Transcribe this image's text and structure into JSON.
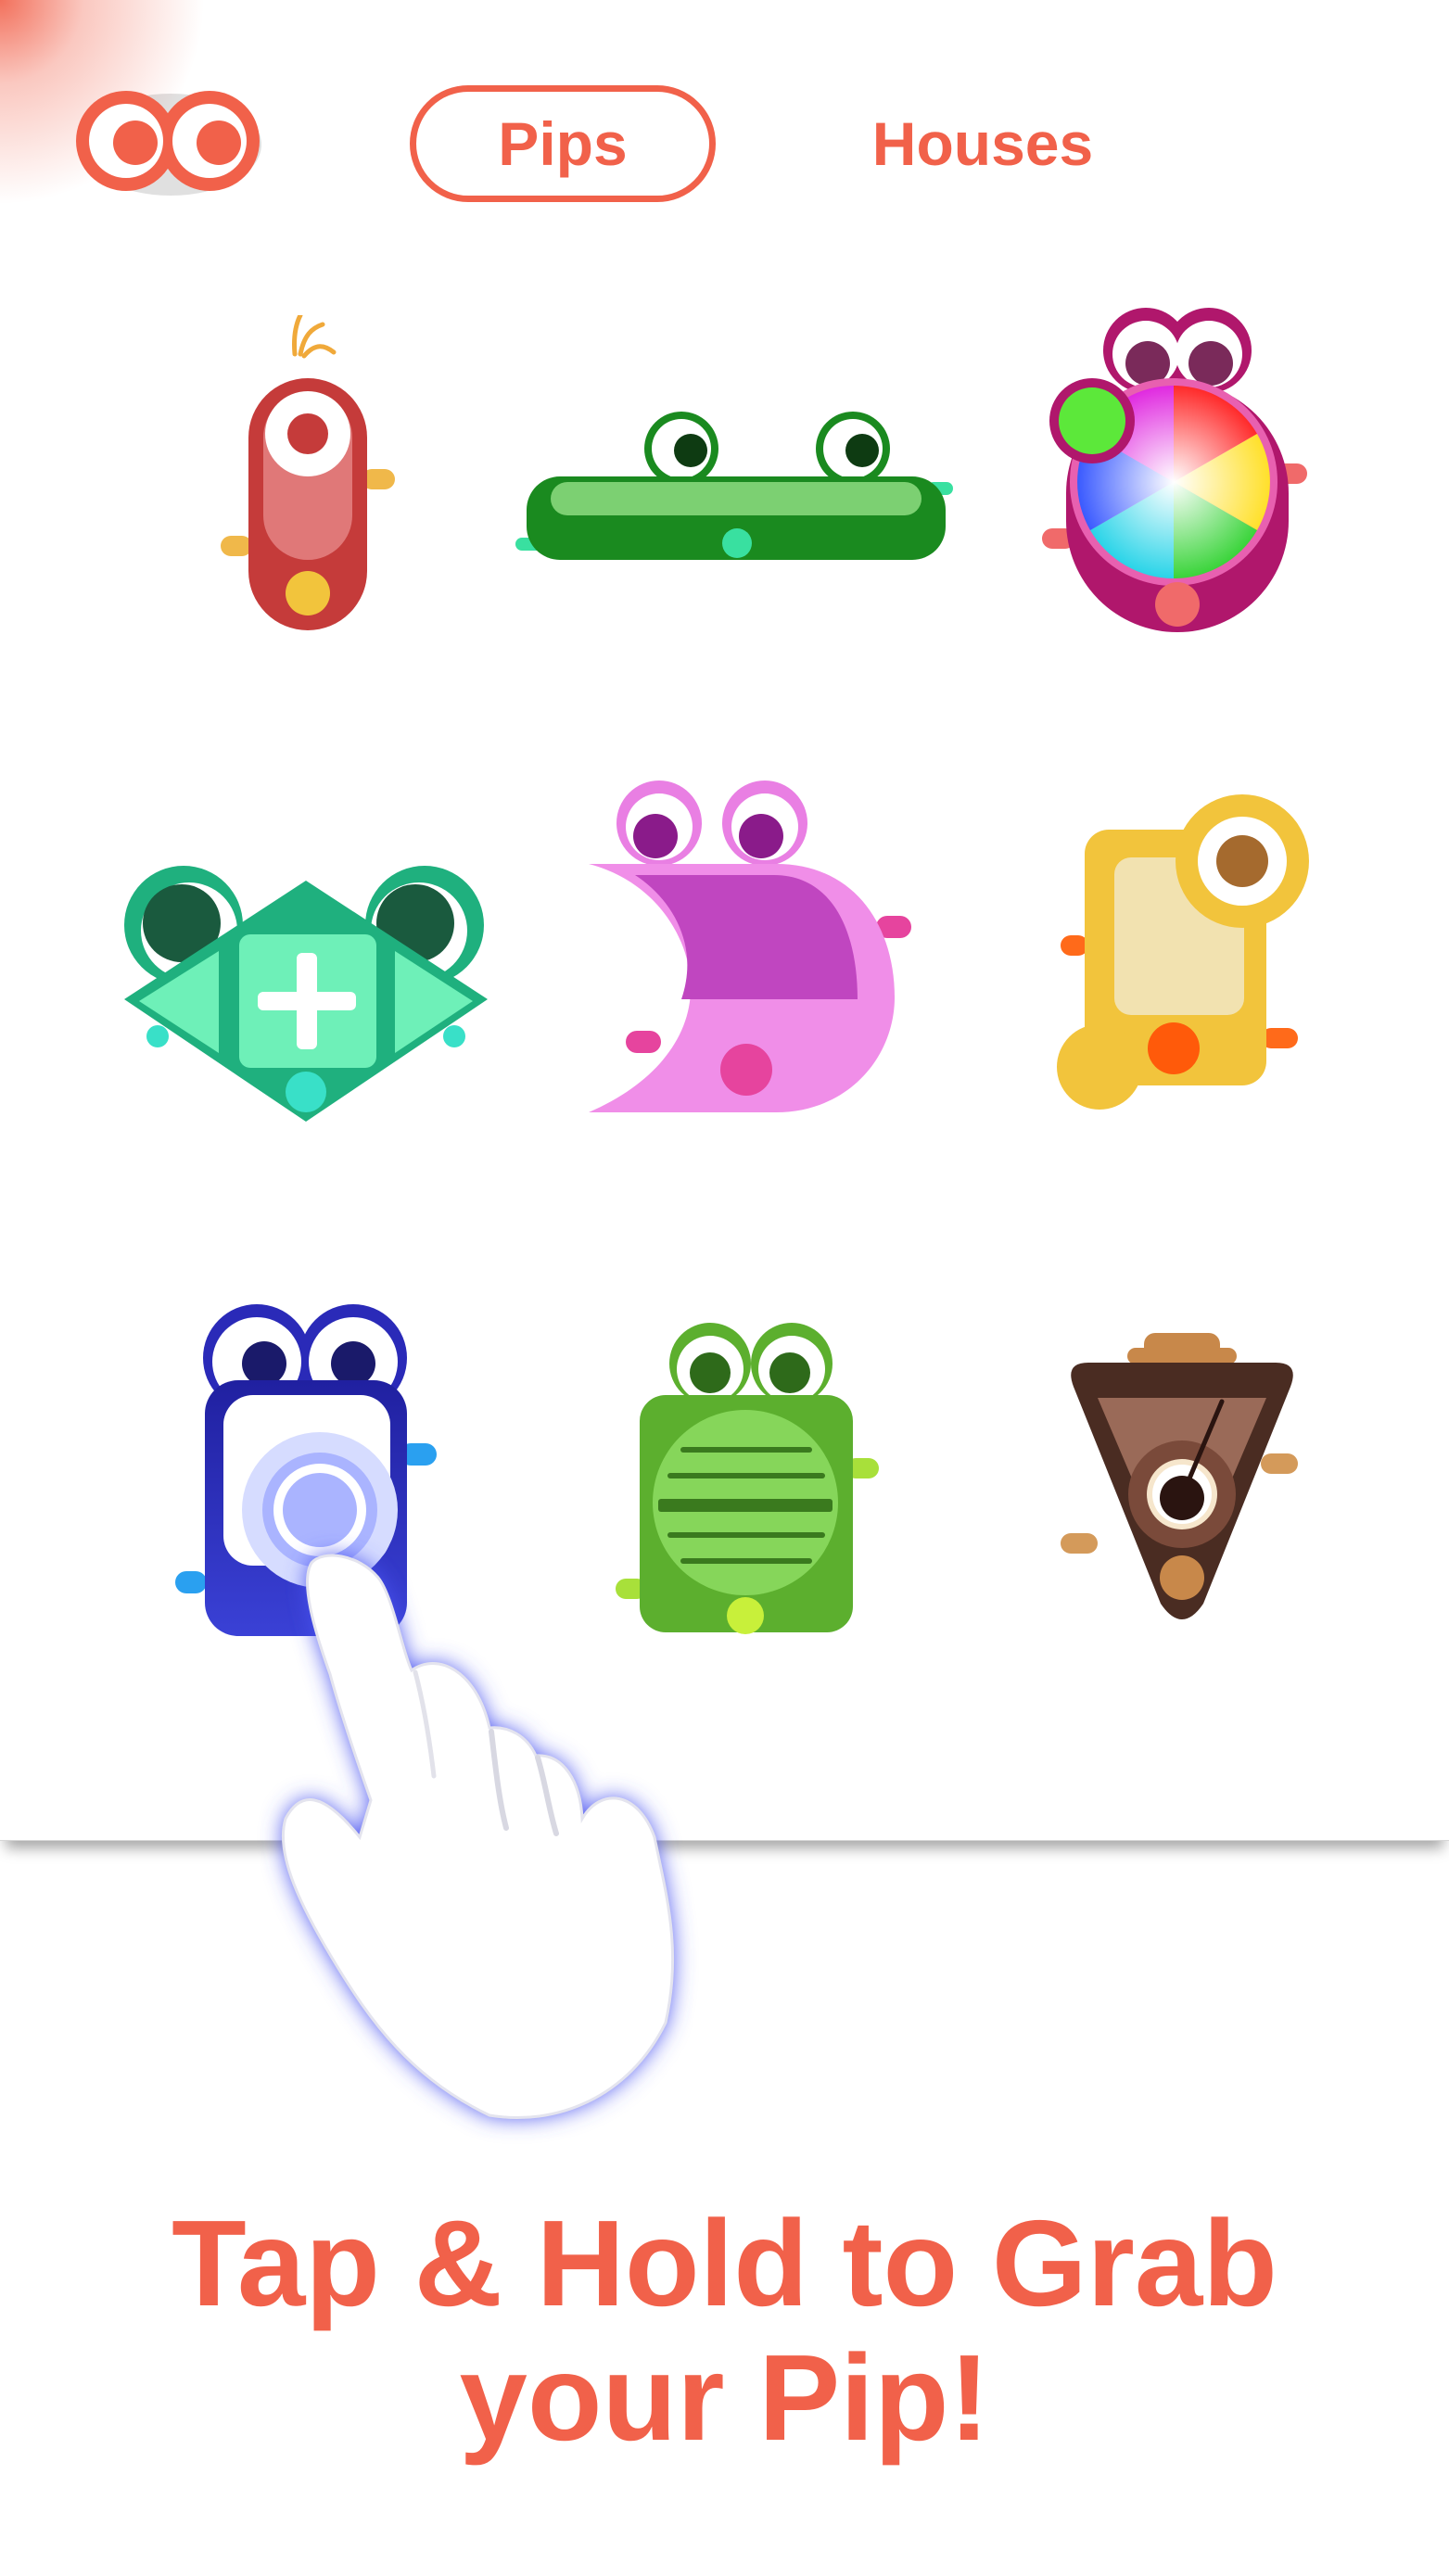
{
  "header": {
    "logo": "pips-eyes-logo",
    "tabs": [
      {
        "label": "Pips",
        "selected": true
      },
      {
        "label": "Houses",
        "selected": false
      }
    ]
  },
  "grid": {
    "pips": [
      {
        "name": "red-pip",
        "color": "#c53b3a"
      },
      {
        "name": "green-long-pip",
        "color": "#1a8a1f"
      },
      {
        "name": "color-wheel-pip",
        "color": "#b0176c"
      },
      {
        "name": "diamond-plus-pip",
        "color": "#1fb07e"
      },
      {
        "name": "pink-crescent-pip",
        "color": "#e97fe3"
      },
      {
        "name": "yellow-pip",
        "color": "#f2c43c"
      },
      {
        "name": "blue-button-pip",
        "color": "#3a41d6"
      },
      {
        "name": "green-speaker-pip",
        "color": "#5caf2e"
      },
      {
        "name": "brown-gauge-pip",
        "color": "#4a2c22"
      }
    ]
  },
  "overlay": {
    "icon": "tap-hand-icon"
  },
  "instruction": {
    "line1": "Tap & Hold to Grab",
    "line2": "your Pip!"
  },
  "colors": {
    "accent": "#f1614a"
  }
}
